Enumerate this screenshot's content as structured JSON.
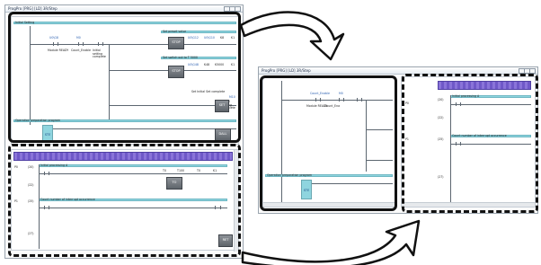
{
  "left_window": {
    "title": "ProgPro [PRG] [LD] 3R/Step",
    "top_panel": {
      "section_label": "Initial Setting",
      "contact_label": "U0\\G8",
      "contact_label_2": "M0",
      "rung_text_a": "Module READY",
      "rung_text_b": "Count_Enable",
      "rung_text_c": "Initial setting complete",
      "set_preset_label": "Set preset value",
      "preset_vals": [
        "U0\\G12",
        "U0\\G10",
        "K8",
        "K1"
      ],
      "stop_label": "STOP",
      "set_switch_label": "Set switch out to T 5000",
      "switch_vals": [
        "U0\\G48",
        "K48",
        "K5000",
        "K1"
      ],
      "stop_label_2": "STOP",
      "set_initial_label": "Set Initial Set complete",
      "set_initial_vals": [
        "M10",
        "Initial setting complete"
      ],
      "set_button": "SET",
      "op_prep_label": "Operation preparation program",
      "step_label": "STE",
      "dall_button": "DALL"
    },
    "bottom_panel": {
      "step_row_1": "P0",
      "initial_processing": "Initial processing A",
      "to_vals": [
        "T0",
        "T100",
        "T0",
        "K1"
      ],
      "to_button": "TO",
      "step_row_2": "P1",
      "count_label": "Count number of interrupt occurrence",
      "ret_button": "RET",
      "step_left_values": [
        "(20)",
        "(22)",
        "(25)",
        "(27)"
      ]
    }
  },
  "right_window": {
    "title": "ProgPro [PRG] [LD] 3R/Step",
    "left_pane": {
      "labels": [
        "Count_Enable",
        "M0",
        "Module READY",
        "Count_Ena"
      ],
      "op_prep_label": "Operation preparation program",
      "step_label": "STE"
    },
    "right_pane": {
      "step_row_1": "P0",
      "initial_processing": "Initial processing A",
      "step_row_2": "P1",
      "count_label": "Count number of interrupt occurrence",
      "step_left_values": [
        "(20)",
        "(22)",
        "(25)",
        "(27)"
      ]
    }
  },
  "colors": {
    "rung_band": "#8fd5df",
    "program_band": "#7a63cf",
    "frame": "#111111"
  }
}
